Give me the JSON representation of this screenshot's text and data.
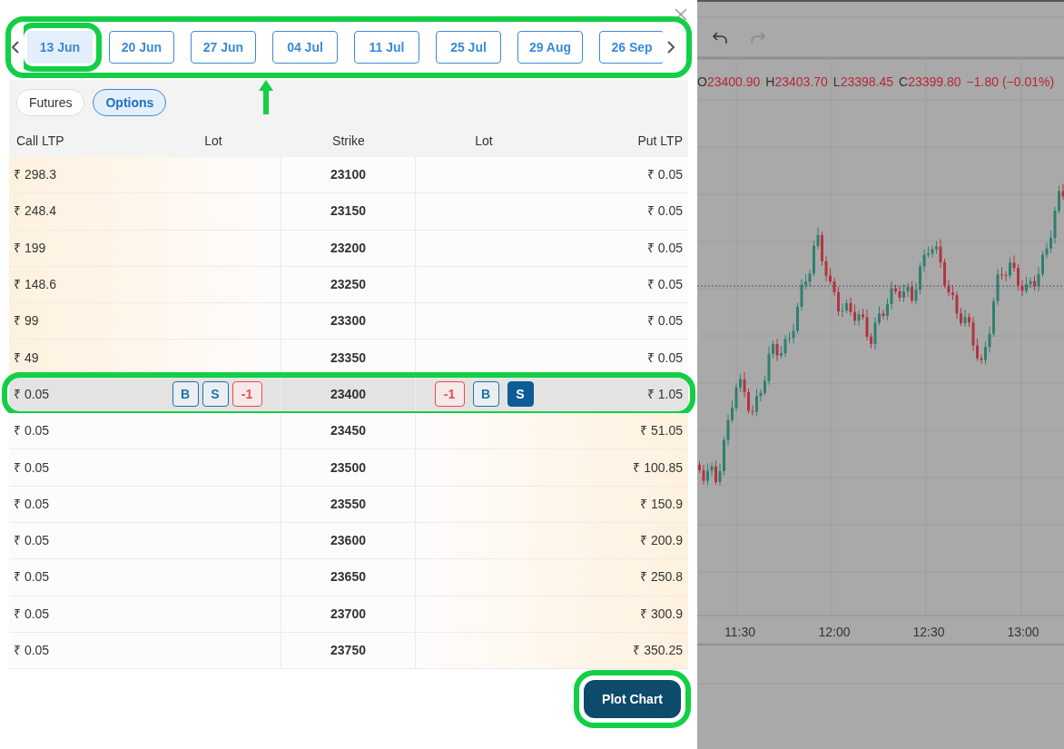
{
  "expiry_strip": {
    "highlighted": true,
    "pointer_arrow": true,
    "expiries": [
      {
        "label": "13 Jun",
        "selected": true,
        "highlighted": true
      },
      {
        "label": "20 Jun",
        "selected": false,
        "highlighted": false
      },
      {
        "label": "27 Jun",
        "selected": false,
        "highlighted": false
      },
      {
        "label": "04 Jul",
        "selected": false,
        "highlighted": false
      },
      {
        "label": "11 Jul",
        "selected": false,
        "highlighted": false
      },
      {
        "label": "25 Jul",
        "selected": false,
        "highlighted": false
      },
      {
        "label": "29 Aug",
        "selected": false,
        "highlighted": false
      },
      {
        "label": "26 Sep",
        "selected": false,
        "highlighted": false
      }
    ]
  },
  "segment_tabs": [
    {
      "label": "Futures",
      "selected": false
    },
    {
      "label": "Options",
      "selected": true
    }
  ],
  "table": {
    "columns": [
      "Call LTP",
      "Lot",
      "Strike",
      "Lot",
      "Put LTP"
    ],
    "rows": [
      {
        "kind": "call_itm",
        "call_ltp": "₹ 298.3",
        "strike": "23100",
        "put_ltp": "₹ 0.05"
      },
      {
        "kind": "call_itm",
        "call_ltp": "₹ 248.4",
        "strike": "23150",
        "put_ltp": "₹ 0.05"
      },
      {
        "kind": "call_itm",
        "call_ltp": "₹ 199",
        "strike": "23200",
        "put_ltp": "₹ 0.05"
      },
      {
        "kind": "call_itm",
        "call_ltp": "₹ 148.6",
        "strike": "23250",
        "put_ltp": "₹ 0.05"
      },
      {
        "kind": "call_itm",
        "call_ltp": "₹ 99",
        "strike": "23300",
        "put_ltp": "₹ 0.05"
      },
      {
        "kind": "call_itm",
        "call_ltp": "₹ 49",
        "strike": "23350",
        "put_ltp": "₹ 0.05"
      },
      {
        "kind": "atm",
        "highlighted": true,
        "call_ltp": "₹ 0.05",
        "strike": "23400",
        "put_ltp": "₹ 1.05",
        "call_actions": [
          {
            "label": "B",
            "kind": "side",
            "selected": false
          },
          {
            "label": "S",
            "kind": "side",
            "selected": false
          },
          {
            "label": "-1",
            "kind": "lot"
          }
        ],
        "put_actions": [
          {
            "label": "-1",
            "kind": "lot"
          },
          {
            "label": "B",
            "kind": "side",
            "selected": false
          },
          {
            "label": "S",
            "kind": "side",
            "selected": true
          }
        ]
      },
      {
        "kind": "put_itm",
        "call_ltp": "₹ 0.05",
        "strike": "23450",
        "put_ltp": "₹ 51.05"
      },
      {
        "kind": "put_itm",
        "call_ltp": "₹ 0.05",
        "strike": "23500",
        "put_ltp": "₹ 100.85"
      },
      {
        "kind": "put_itm",
        "call_ltp": "₹ 0.05",
        "strike": "23550",
        "put_ltp": "₹ 150.9"
      },
      {
        "kind": "put_itm",
        "call_ltp": "₹ 0.05",
        "strike": "23600",
        "put_ltp": "₹ 200.9"
      },
      {
        "kind": "put_itm",
        "call_ltp": "₹ 0.05",
        "strike": "23650",
        "put_ltp": "₹ 250.8"
      },
      {
        "kind": "put_itm",
        "call_ltp": "₹ 0.05",
        "strike": "23700",
        "put_ltp": "₹ 300.9"
      },
      {
        "kind": "put_itm",
        "call_ltp": "₹ 0.05",
        "strike": "23750",
        "put_ltp": "₹ 350.25"
      }
    ]
  },
  "plot_button": {
    "label": "Plot Chart",
    "highlighted": true
  },
  "chart": {
    "ohlc": [
      {
        "label": "O",
        "value": "23400.90"
      },
      {
        "label": "H",
        "value": "23403.70"
      },
      {
        "label": "L",
        "value": "23398.45"
      },
      {
        "label": "C",
        "value": "23399.80"
      }
    ],
    "change": "−1.80 (−0.01%)",
    "time_labels": [
      "11:30",
      "12:00",
      "12:30",
      "13:00"
    ]
  }
}
